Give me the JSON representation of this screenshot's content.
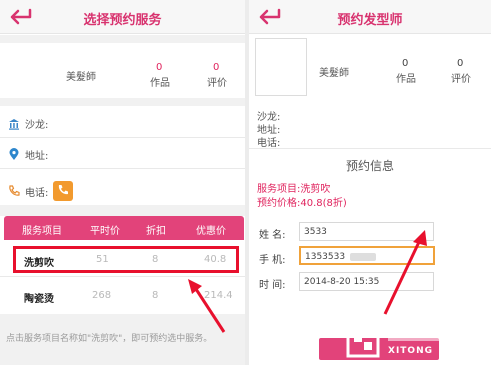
{
  "left": {
    "title": "选择预约服务",
    "stylist": {
      "name": "美髮師",
      "works_count": "0",
      "works_label": "作品",
      "reviews_count": "0",
      "reviews_label": "评价"
    },
    "salon_label": "沙龙:",
    "address_label": "地址:",
    "phone_label": "电话:",
    "table": {
      "headers": [
        "服务项目",
        "平时价",
        "折扣",
        "优惠价"
      ],
      "rows": [
        [
          "洗剪吹",
          "51",
          "8",
          "40.8"
        ],
        [
          "陶瓷烫",
          "268",
          "8",
          "214.4"
        ]
      ]
    },
    "hint": "点击服务项目名称如\"洗剪吹\"，即可预约选中服务。"
  },
  "right": {
    "title": "预约发型师",
    "stylist": {
      "name": "美髮師",
      "works_count": "0",
      "works_label": "作品",
      "reviews_count": "0",
      "reviews_label": "评价"
    },
    "salon_label": "沙龙:",
    "address_label": "地址:",
    "phone_label": "电话:",
    "section_title": "预约信息",
    "service_item": "服务项目:洗剪吹",
    "service_price": "预约价格:40.8(8折)",
    "form": {
      "name_label": "姓  名:",
      "name_value": "3533",
      "phone_label": "手  机:",
      "phone_value": "1353533",
      "time_label": "时  间:",
      "time_value": "2014-8-20 15:35"
    },
    "watermark": "XITONG"
  },
  "colors": {
    "accent": "#e2437a",
    "title": "#d8336f",
    "highlight_box": "#e8102d",
    "arrow": "#e8102d",
    "focus_border": "#f0a23a"
  },
  "icons": [
    "back-arrow-icon",
    "building-icon",
    "location-pin-icon",
    "phone-icon",
    "phone-call-button-icon",
    "red-arrow-icon"
  ]
}
